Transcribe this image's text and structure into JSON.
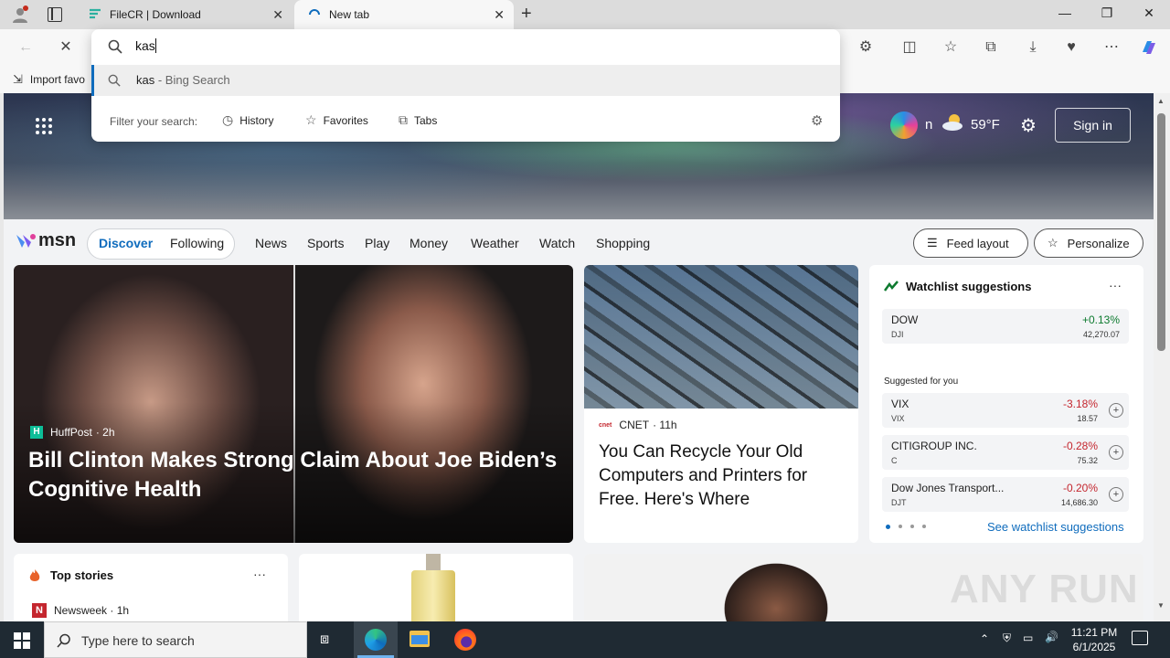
{
  "tabs": [
    {
      "title": "FileCR | Download",
      "close": "✕"
    },
    {
      "title": "New tab",
      "close": "✕"
    }
  ],
  "new_tab": "+",
  "window": {
    "minimize": "—",
    "restore": "❐",
    "close": "✕"
  },
  "omnibox": {
    "query": "kas",
    "suggestion": {
      "text": "kas",
      "source": "- Bing Search"
    },
    "filter_label": "Filter your search:",
    "filters": [
      "History",
      "Favorites",
      "Tabs"
    ]
  },
  "favorites_bar": {
    "import_label": "Import favo"
  },
  "header": {
    "partial_text": "n",
    "weather_temp": "59°F",
    "sign_in": "Sign in"
  },
  "nav": {
    "brand": "msn",
    "tabs": [
      "Discover",
      "Following"
    ],
    "links": [
      "News",
      "Sports",
      "Play",
      "Money",
      "Weather",
      "Watch",
      "Shopping"
    ],
    "feed_layout": "Feed layout",
    "personalize": "Personalize"
  },
  "main_story": {
    "source": "HuffPost",
    "age": "· 2h",
    "headline": "Bill Clinton Makes Strong Claim About Joe Biden’s Cognitive Health"
  },
  "side_story": {
    "source_logo": "cnet",
    "source": "CNET",
    "age": "· 11h",
    "headline": "You Can Recycle Your Old Computers and Printers for Free. Here's Where"
  },
  "watchlist": {
    "title": "Watchlist suggestions",
    "menu": "···",
    "primary": {
      "name": "DOW",
      "symbol": "DJI",
      "change": "+0.13%",
      "price": "42,270.07"
    },
    "suggested_label": "Suggested for you",
    "stocks": [
      {
        "name": "VIX",
        "symbol": "VIX",
        "change": "-3.18%",
        "price": "18.57"
      },
      {
        "name": "CITIGROUP INC.",
        "symbol": "C",
        "change": "-0.28%",
        "price": "75.32"
      },
      {
        "name": "Dow Jones Transport...",
        "symbol": "DJT",
        "change": "-0.20%",
        "price": "14,686.30"
      }
    ],
    "see_more": "See watchlist suggestions"
  },
  "top_stories": {
    "title": "Top stories",
    "menu": "···",
    "first_source": "Newsweek",
    "first_age": "· 1h"
  },
  "watermark": "ANY RUN",
  "taskbar": {
    "search_placeholder": "Type here to search",
    "time": "11:21 PM",
    "date": "6/1/2025"
  },
  "colors": {
    "positive": "#0d7a2f",
    "negative": "#c4262e",
    "accent": "#0f6cbd"
  }
}
